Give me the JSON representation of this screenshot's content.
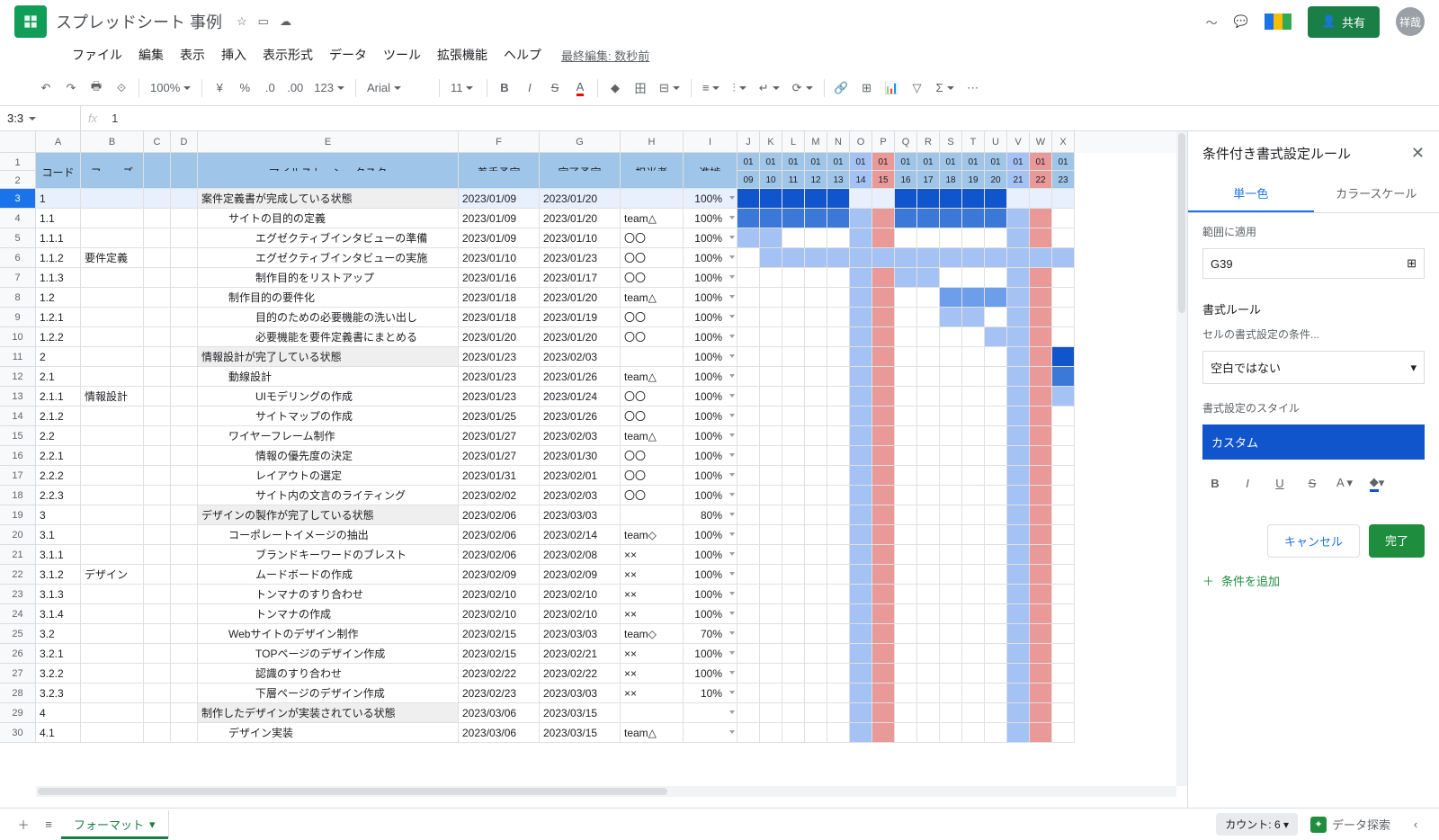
{
  "titlebar": {
    "title": "スプレッドシート 事例",
    "share": "共有",
    "avatar": "祥哉"
  },
  "menubar": [
    "ファイル",
    "編集",
    "表示",
    "挿入",
    "表示形式",
    "データ",
    "ツール",
    "拡張機能",
    "ヘルプ"
  ],
  "last_edit": "最終編集: 数秒前",
  "toolbar": {
    "zoom": "100%",
    "currency": "¥",
    "pct": "%",
    "dec0": ".0",
    "dec00": ".00",
    "numfmt": "123",
    "font": "Arial",
    "size": "11"
  },
  "namebox": "3:3",
  "formula": "1",
  "cols": {
    "letters": [
      "A",
      "B",
      "C",
      "D",
      "E",
      "F",
      "G",
      "H",
      "I",
      "J",
      "K",
      "L",
      "M",
      "N",
      "O",
      "P",
      "Q",
      "R",
      "S",
      "T",
      "U",
      "V",
      "W",
      "X"
    ],
    "widths": [
      50,
      70,
      30,
      30,
      290,
      90,
      90,
      70,
      60,
      25,
      25,
      25,
      25,
      25,
      25,
      25,
      25,
      25,
      25,
      25,
      25,
      25,
      25,
      25
    ]
  },
  "header1": {
    "A": "コード",
    "B": "フェーズ",
    "E": "マイルストーン・タスク",
    "F": "着手予定",
    "G": "完了予定",
    "H": "担当者",
    "I": "進捗"
  },
  "date_month": [
    "01",
    "01",
    "01",
    "01",
    "01",
    "01",
    "01",
    "01",
    "01",
    "01",
    "01",
    "01",
    "01",
    "01",
    "01"
  ],
  "date_day": [
    "09",
    "10",
    "11",
    "12",
    "13",
    "14",
    "15",
    "16",
    "17",
    "18",
    "19",
    "20",
    "21",
    "22",
    "23"
  ],
  "weekend": {
    "sat": [
      5,
      12
    ],
    "sun": [
      6,
      13
    ]
  },
  "rows": [
    {
      "n": 3,
      "code": "1",
      "phase": "",
      "task": "案件定義書が完成している状態",
      "start": "2023/01/09",
      "end": "2023/01/20",
      "owner": "",
      "pct": "100%",
      "ms": true,
      "sel": true,
      "g": [
        [
          0,
          5,
          1
        ],
        [
          7,
          12,
          1
        ]
      ]
    },
    {
      "n": 4,
      "code": "1.1",
      "task": "サイトの目的の定義",
      "start": "2023/01/09",
      "end": "2023/01/20",
      "owner": "team△",
      "pct": "100%",
      "indent": 1,
      "g": [
        [
          0,
          5,
          2
        ],
        [
          7,
          12,
          2
        ]
      ]
    },
    {
      "n": 5,
      "code": "1.1.1",
      "task": "エグゼクティブインタビューの準備",
      "start": "2023/01/09",
      "end": "2023/01/10",
      "owner": "〇〇",
      "pct": "100%",
      "indent": 2,
      "g": [
        [
          0,
          2,
          4
        ]
      ]
    },
    {
      "n": 6,
      "code": "1.1.2",
      "task": "エグゼクティブインタビューの実施",
      "start": "2023/01/10",
      "end": "2023/01/23",
      "owner": "〇〇",
      "pct": "100%",
      "phase": "要件定義",
      "indent": 2,
      "g": [
        [
          1,
          15,
          4
        ]
      ]
    },
    {
      "n": 7,
      "code": "1.1.3",
      "task": "制作目的をリストアップ",
      "start": "2023/01/16",
      "end": "2023/01/17",
      "owner": "〇〇",
      "pct": "100%",
      "indent": 2,
      "g": [
        [
          7,
          9,
          4
        ]
      ]
    },
    {
      "n": 8,
      "code": "1.2",
      "task": "制作目的の要件化",
      "start": "2023/01/18",
      "end": "2023/01/20",
      "owner": "team△",
      "pct": "100%",
      "indent": 1,
      "g": [
        [
          9,
          12,
          3
        ]
      ]
    },
    {
      "n": 9,
      "code": "1.2.1",
      "task": "目的のための必要機能の洗い出し",
      "start": "2023/01/18",
      "end": "2023/01/19",
      "owner": "〇〇",
      "pct": "100%",
      "indent": 2,
      "g": [
        [
          9,
          11,
          4
        ]
      ]
    },
    {
      "n": 10,
      "code": "1.2.2",
      "task": "必要機能を要件定義書にまとめる",
      "start": "2023/01/20",
      "end": "2023/01/20",
      "owner": "〇〇",
      "pct": "100%",
      "indent": 2,
      "g": [
        [
          11,
          12,
          4
        ]
      ]
    },
    {
      "n": 11,
      "code": "2",
      "task": "情報設計が完了している状態",
      "start": "2023/01/23",
      "end": "2023/02/03",
      "pct": "100%",
      "ms": true,
      "g": [
        [
          14,
          15,
          1
        ]
      ]
    },
    {
      "n": 12,
      "code": "2.1",
      "task": "動線設計",
      "start": "2023/01/23",
      "end": "2023/01/26",
      "owner": "team△",
      "pct": "100%",
      "indent": 1,
      "g": [
        [
          14,
          15,
          2
        ]
      ]
    },
    {
      "n": 13,
      "code": "2.1.1",
      "task": "UIモデリングの作成",
      "start": "2023/01/23",
      "end": "2023/01/24",
      "owner": "〇〇",
      "pct": "100%",
      "phase": "情報設計",
      "indent": 2,
      "g": [
        [
          14,
          15,
          4
        ]
      ]
    },
    {
      "n": 14,
      "code": "2.1.2",
      "task": "サイトマップの作成",
      "start": "2023/01/25",
      "end": "2023/01/26",
      "owner": "〇〇",
      "pct": "100%",
      "indent": 2,
      "g": []
    },
    {
      "n": 15,
      "code": "2.2",
      "task": "ワイヤーフレーム制作",
      "start": "2023/01/27",
      "end": "2023/02/03",
      "owner": "team△",
      "pct": "100%",
      "indent": 1,
      "g": []
    },
    {
      "n": 16,
      "code": "2.2.1",
      "task": "情報の優先度の決定",
      "start": "2023/01/27",
      "end": "2023/01/30",
      "owner": "〇〇",
      "pct": "100%",
      "indent": 2,
      "g": []
    },
    {
      "n": 17,
      "code": "2.2.2",
      "task": "レイアウトの選定",
      "start": "2023/01/31",
      "end": "2023/02/01",
      "owner": "〇〇",
      "pct": "100%",
      "indent": 2,
      "g": []
    },
    {
      "n": 18,
      "code": "2.2.3",
      "task": "サイト内の文言のライティング",
      "start": "2023/02/02",
      "end": "2023/02/03",
      "owner": "〇〇",
      "pct": "100%",
      "indent": 2,
      "g": []
    },
    {
      "n": 19,
      "code": "3",
      "task": "デザインの製作が完了している状態",
      "start": "2023/02/06",
      "end": "2023/03/03",
      "pct": "80%",
      "ms": true,
      "g": []
    },
    {
      "n": 20,
      "code": "3.1",
      "task": "コーポレートイメージの抽出",
      "start": "2023/02/06",
      "end": "2023/02/14",
      "owner": "team◇",
      "pct": "100%",
      "indent": 1,
      "g": []
    },
    {
      "n": 21,
      "code": "3.1.1",
      "task": "ブランドキーワードのブレスト",
      "start": "2023/02/06",
      "end": "2023/02/08",
      "owner": "××",
      "pct": "100%",
      "indent": 2,
      "g": []
    },
    {
      "n": 22,
      "code": "3.1.2",
      "task": "ムードボードの作成",
      "start": "2023/02/09",
      "end": "2023/02/09",
      "owner": "××",
      "pct": "100%",
      "phase": "デザイン",
      "indent": 2,
      "g": []
    },
    {
      "n": 23,
      "code": "3.1.3",
      "task": "トンマナのすり合わせ",
      "start": "2023/02/10",
      "end": "2023/02/10",
      "owner": "××",
      "pct": "100%",
      "indent": 2,
      "g": []
    },
    {
      "n": 24,
      "code": "3.1.4",
      "task": "トンマナの作成",
      "start": "2023/02/10",
      "end": "2023/02/10",
      "owner": "××",
      "pct": "100%",
      "indent": 2,
      "g": []
    },
    {
      "n": 25,
      "code": "3.2",
      "task": "Webサイトのデザイン制作",
      "start": "2023/02/15",
      "end": "2023/03/03",
      "owner": "team◇",
      "pct": "70%",
      "indent": 1,
      "g": []
    },
    {
      "n": 26,
      "code": "3.2.1",
      "task": "TOPページのデザイン作成",
      "start": "2023/02/15",
      "end": "2023/02/21",
      "owner": "××",
      "pct": "100%",
      "indent": 2,
      "g": []
    },
    {
      "n": 27,
      "code": "3.2.2",
      "task": "認識のすり合わせ",
      "start": "2023/02/22",
      "end": "2023/02/22",
      "owner": "××",
      "pct": "100%",
      "indent": 2,
      "g": []
    },
    {
      "n": 28,
      "code": "3.2.3",
      "task": "下層ページのデザイン作成",
      "start": "2023/02/23",
      "end": "2023/03/03",
      "owner": "××",
      "pct": "10%",
      "indent": 2,
      "g": []
    },
    {
      "n": 29,
      "code": "4",
      "task": "制作したデザインが実装されている状態",
      "start": "2023/03/06",
      "end": "2023/03/15",
      "pct": "",
      "ms": true,
      "g": []
    },
    {
      "n": 30,
      "code": "4.1",
      "task": "デザイン実装",
      "start": "2023/03/06",
      "end": "2023/03/15",
      "owner": "team△",
      "pct": "",
      "indent": 1,
      "g": []
    }
  ],
  "sidebar": {
    "title": "条件付き書式設定ルール",
    "tab1": "単一色",
    "tab2": "カラースケール",
    "range_label": "範囲に適用",
    "range": "G39",
    "rules_label": "書式ルール",
    "condition_label": "セルの書式設定の条件...",
    "condition": "空白ではない",
    "style_label": "書式設定のスタイル",
    "custom": "カスタム",
    "cancel": "キャンセル",
    "done": "完了",
    "add": "条件を追加"
  },
  "footer": {
    "sheet": "フォーマット",
    "count": "カウント: 6",
    "explore": "データ探索"
  }
}
